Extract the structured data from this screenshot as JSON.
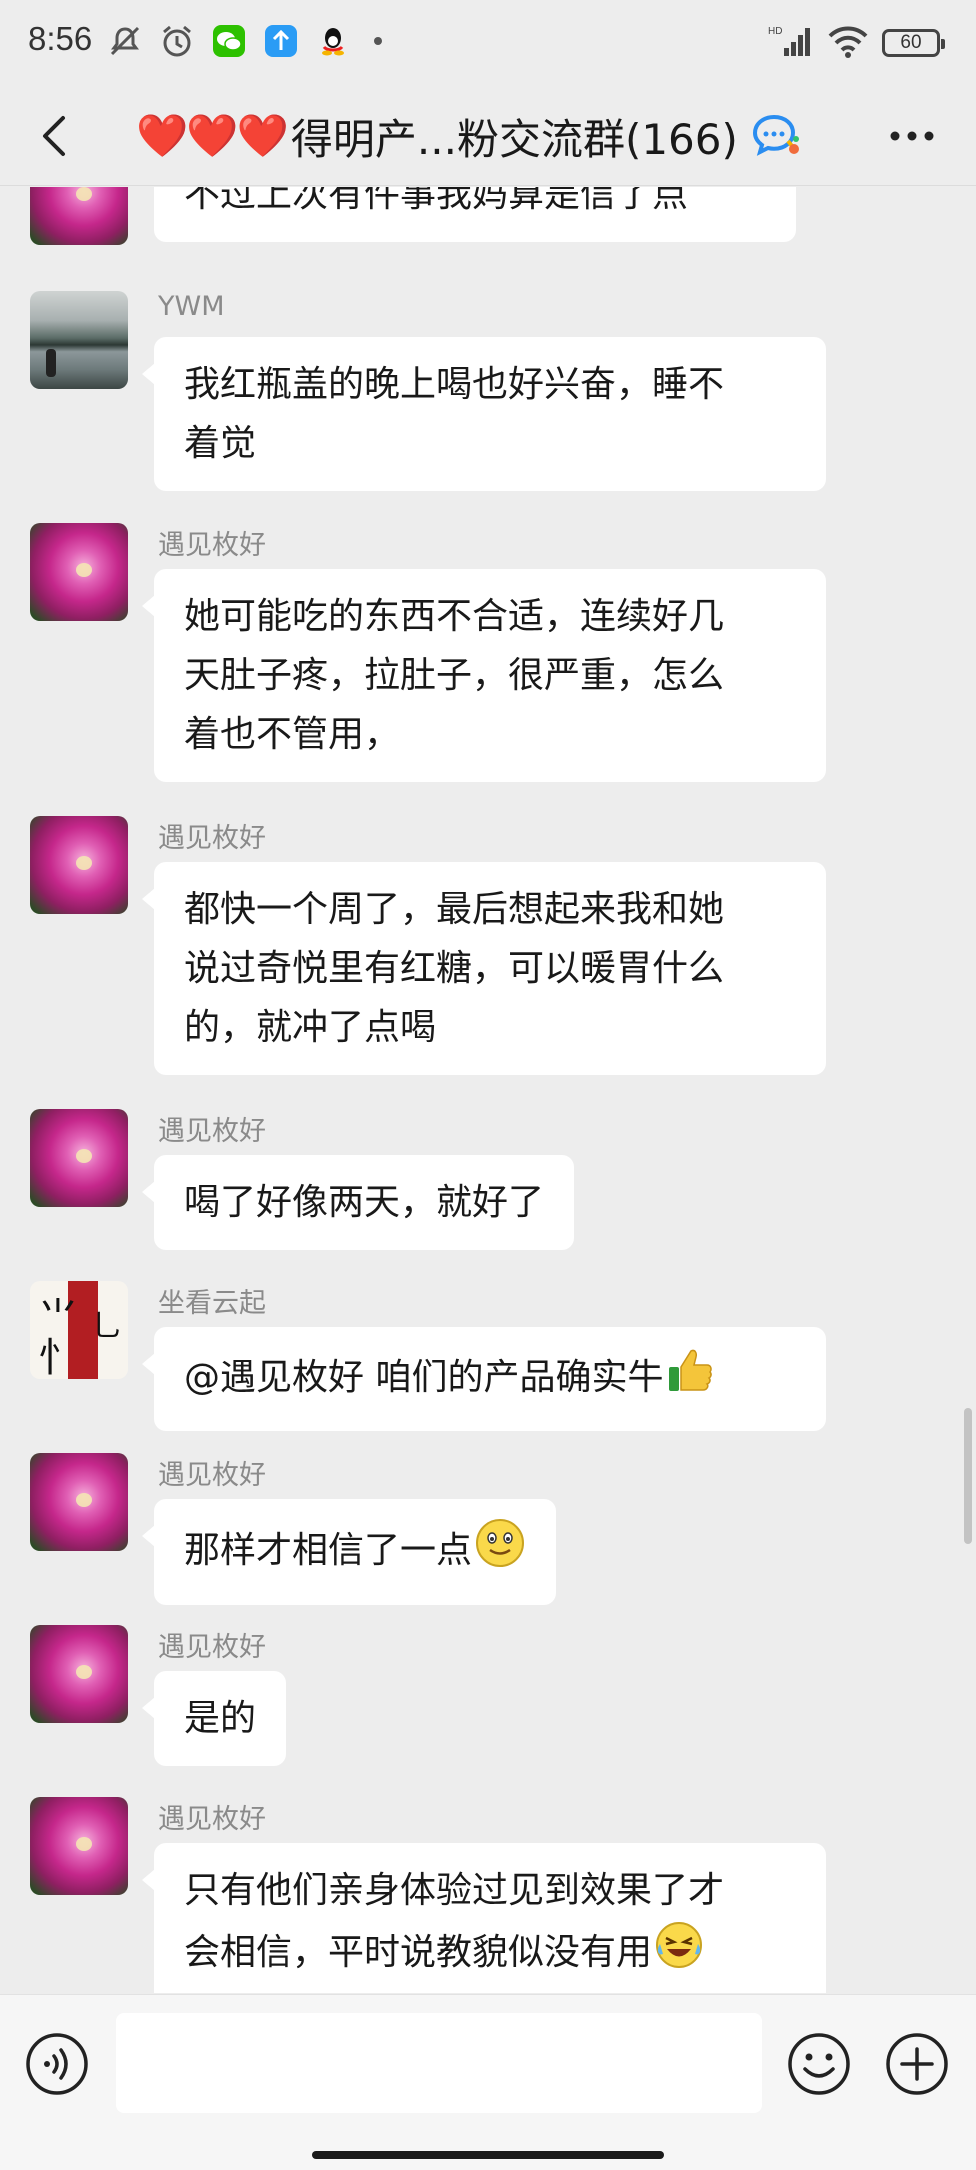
{
  "status_bar": {
    "time": "8:56",
    "left_icons": [
      "mute-vibrate-icon",
      "alarm-icon",
      "wechat-icon",
      "upload-icon",
      "qq-icon"
    ],
    "network_label": "HD",
    "battery": "60"
  },
  "header": {
    "back_icon": "chevron-left-icon",
    "hearts": "❤️❤️❤️",
    "title": "得明产...粉交流群(166)",
    "more_icon": "more-dots-icon"
  },
  "messages": [
    {
      "sender": "",
      "avatar": "flower",
      "lines": [
        "不过上次有件事我妈算是信了点"
      ],
      "emoji": ""
    },
    {
      "sender": "YWM",
      "avatar": "lake",
      "lines": [
        "我红瓶盖的晚上喝也好兴奋，睡不",
        "着觉"
      ],
      "emoji": ""
    },
    {
      "sender": "遇见枚好",
      "avatar": "flower",
      "lines": [
        "她可能吃的东西不合适，连续好几",
        "天肚子疼，拉肚子，很严重，怎么",
        "着也不管用，"
      ],
      "emoji": ""
    },
    {
      "sender": "遇见枚好",
      "avatar": "flower",
      "lines": [
        "都快一个周了，最后想起来我和她",
        "说过奇悦里有红糖，可以暖胃什么",
        "的，就冲了点喝"
      ],
      "emoji": ""
    },
    {
      "sender": "遇见枚好",
      "avatar": "flower",
      "lines": [
        "喝了好像两天，就好了"
      ],
      "emoji": ""
    },
    {
      "sender": "坐看云起",
      "avatar": "calligraphy",
      "lines": [
        "@遇见枚好   咱们的产品确实牛"
      ],
      "emoji": "👍"
    },
    {
      "sender": "遇见枚好",
      "avatar": "flower",
      "lines": [
        "那样才相信了一点"
      ],
      "emoji": "🙂"
    },
    {
      "sender": "遇见枚好",
      "avatar": "flower",
      "lines": [
        "是的"
      ],
      "emoji": ""
    },
    {
      "sender": "遇见枚好",
      "avatar": "flower",
      "lines": [
        "只有他们亲身体验过见到效果了才",
        "会相信，平时说教貌似没有用"
      ],
      "emoji": "😂"
    }
  ],
  "input_bar": {
    "voice_icon": "voice-icon",
    "placeholder": "",
    "emoji_icon": "emoji-face-icon",
    "plus_icon": "plus-circle-icon"
  },
  "colors": {
    "background": "#ededed",
    "bubble": "#ffffff",
    "sender_name": "#8a8a8a",
    "title_heart": "#e22222"
  }
}
